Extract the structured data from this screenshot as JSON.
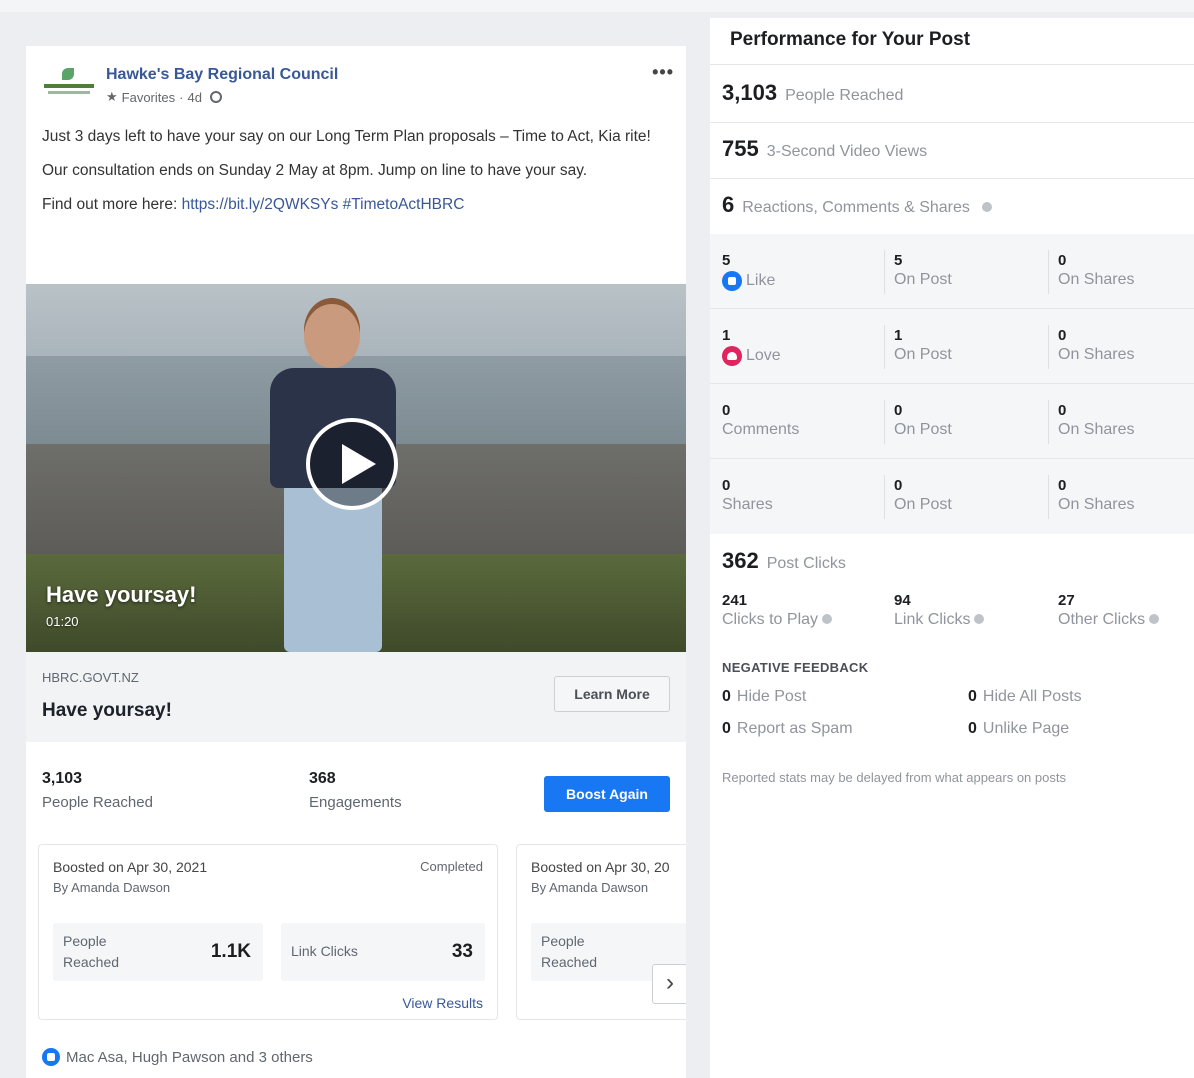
{
  "post": {
    "page_name": "Hawke's Bay Regional Council",
    "favorites": "Favorites",
    "age": "4d",
    "more": "•••",
    "text_line1": "Just 3 days left to have your say on our Long Term Plan proposals – Time to Act, Kia rite!",
    "text_line2": "Our consultation ends on Sunday 2 May at 8pm. Jump on line to have your say.",
    "find_out_prefix": "Find out more here:",
    "link_url": "https://bit.ly/2QWKSYs",
    "hashtag": "#TimetoActHBRC",
    "video_title": "Have yoursay!",
    "video_duration": "01:20",
    "preview_domain": "HBRC.GOVT.NZ",
    "preview_title": "Have yoursay!",
    "learn_more": "Learn More",
    "stats": {
      "reached_value": "3,103",
      "reached_label": "People Reached",
      "engagements_value": "368",
      "engagements_label": "Engagements",
      "boost_again": "Boost Again"
    },
    "boosts": [
      {
        "date": "Boosted on Apr 30, 2021",
        "by": "By Amanda Dawson",
        "status": "Completed",
        "people_label": "People Reached",
        "people_value": "1.1K",
        "clicks_label": "Link Clicks",
        "clicks_value": "33",
        "view_results": "View Results"
      },
      {
        "date": "Boosted on Apr 30, 20",
        "by": "By Amanda Dawson",
        "people_label": "People Reached"
      }
    ],
    "next_arrow": "›",
    "reactors": "Mac Asa, Hugh Pawson and 3 others"
  },
  "performance": {
    "title": "Performance for Your Post",
    "reached": {
      "value": "3,103",
      "label": "People Reached"
    },
    "video_views": {
      "value": "755",
      "label": "3-Second Video Views"
    },
    "reactions": {
      "value": "6",
      "label": "Reactions, Comments & Shares"
    },
    "rows": [
      {
        "total": "5",
        "label": "Like",
        "icon": "like-icon",
        "on_post": "5",
        "on_shares": "0"
      },
      {
        "total": "1",
        "label": "Love",
        "icon": "love-icon",
        "on_post": "1",
        "on_shares": "0"
      },
      {
        "total": "0",
        "label": "Comments",
        "icon": "",
        "on_post": "0",
        "on_shares": "0"
      },
      {
        "total": "0",
        "label": "Shares",
        "icon": "",
        "on_post": "0",
        "on_shares": "0"
      }
    ],
    "on_post_label": "On Post",
    "on_shares_label": "On Shares",
    "post_clicks": {
      "value": "362",
      "label": "Post Clicks"
    },
    "clicks": [
      {
        "value": "241",
        "label": "Clicks to Play"
      },
      {
        "value": "94",
        "label": "Link Clicks"
      },
      {
        "value": "27",
        "label": "Other Clicks"
      }
    ],
    "negative_header": "NEGATIVE FEEDBACK",
    "negative": [
      {
        "value": "0",
        "label": "Hide Post"
      },
      {
        "value": "0",
        "label": "Hide All Posts"
      },
      {
        "value": "0",
        "label": "Report as Spam"
      },
      {
        "value": "0",
        "label": "Unlike Page"
      }
    ],
    "note": "Reported stats may be delayed from what appears on posts"
  },
  "colors": {
    "accent": "#1877f2",
    "link": "#385898",
    "love": "#e0245e"
  }
}
